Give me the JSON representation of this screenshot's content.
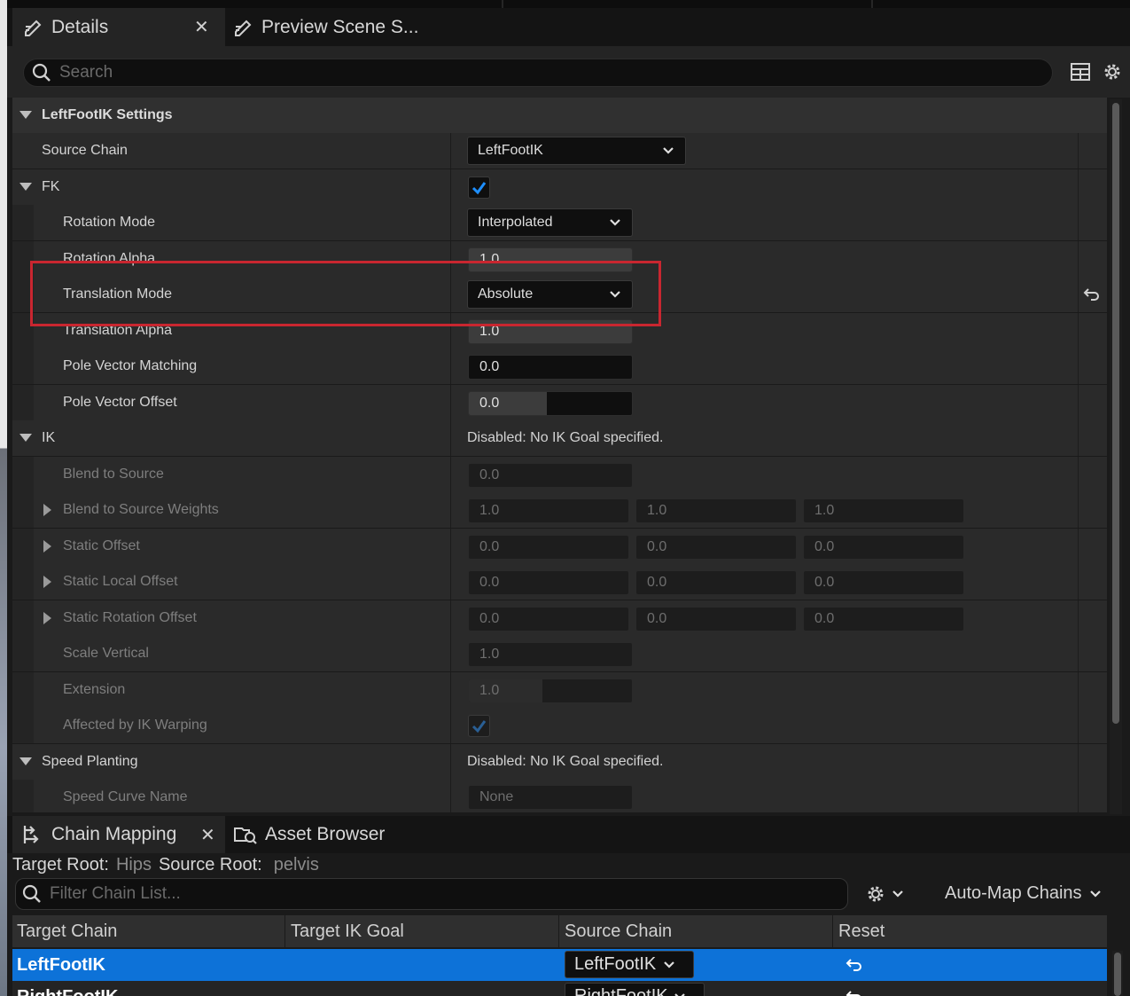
{
  "tabs_top": {
    "details_label": "Details",
    "preview_label": "Preview Scene S..."
  },
  "search": {
    "placeholder": "Search"
  },
  "category_title": "LeftFootIK Settings",
  "rows": {
    "source_chain": {
      "label": "Source Chain",
      "value": "LeftFootIK"
    },
    "fk": {
      "label": "FK",
      "checked": true
    },
    "rotation_mode": {
      "label": "Rotation Mode",
      "value": "Interpolated"
    },
    "rotation_alpha": {
      "label": "Rotation Alpha",
      "value": "1.0"
    },
    "translation_mode": {
      "label": "Translation Mode",
      "value": "Absolute"
    },
    "translation_alpha": {
      "label": "Translation Alpha",
      "value": "1.0"
    },
    "pole_vector_matching": {
      "label": "Pole Vector Matching",
      "value": "0.0"
    },
    "pole_vector_offset": {
      "label": "Pole Vector Offset",
      "value": "0.0"
    },
    "ik": {
      "label": "IK",
      "info": "Disabled: No IK Goal specified."
    },
    "blend_to_source": {
      "label": "Blend to Source",
      "value": "0.0"
    },
    "blend_to_source_weights": {
      "label": "Blend to Source Weights",
      "values": [
        "1.0",
        "1.0",
        "1.0"
      ]
    },
    "static_offset": {
      "label": "Static Offset",
      "values": [
        "0.0",
        "0.0",
        "0.0"
      ]
    },
    "static_local_offset": {
      "label": "Static Local Offset",
      "values": [
        "0.0",
        "0.0",
        "0.0"
      ]
    },
    "static_rotation_offset": {
      "label": "Static Rotation Offset",
      "values": [
        "0.0",
        "0.0",
        "0.0"
      ]
    },
    "scale_vertical": {
      "label": "Scale Vertical",
      "value": "1.0"
    },
    "extension": {
      "label": "Extension",
      "value": "1.0"
    },
    "affected_by_ik_warping": {
      "label": "Affected by IK Warping",
      "checked": true
    },
    "speed_planting": {
      "label": "Speed Planting",
      "info": "Disabled: No IK Goal specified."
    },
    "speed_curve_name": {
      "label": "Speed Curve Name",
      "value": "None"
    }
  },
  "tabs_bottom": {
    "chain_mapping_label": "Chain Mapping",
    "asset_browser_label": "Asset Browser"
  },
  "roots": {
    "target_label": "Target Root:",
    "target_value": "Hips",
    "source_label": "Source Root:",
    "source_value": "pelvis"
  },
  "filter": {
    "placeholder": "Filter Chain List..."
  },
  "auto_map_label": "Auto-Map Chains",
  "table": {
    "headers": [
      "Target Chain",
      "Target IK Goal",
      "Source Chain",
      "Reset"
    ],
    "rows": [
      {
        "target": "LeftFootIK",
        "source": "LeftFootIK"
      },
      {
        "target": "RightFootIK",
        "source": "RightFootIK"
      }
    ]
  },
  "colors": {
    "selection": "#0d72d8",
    "highlight_box": "#c92630",
    "check_blue": "#1e8fff"
  }
}
